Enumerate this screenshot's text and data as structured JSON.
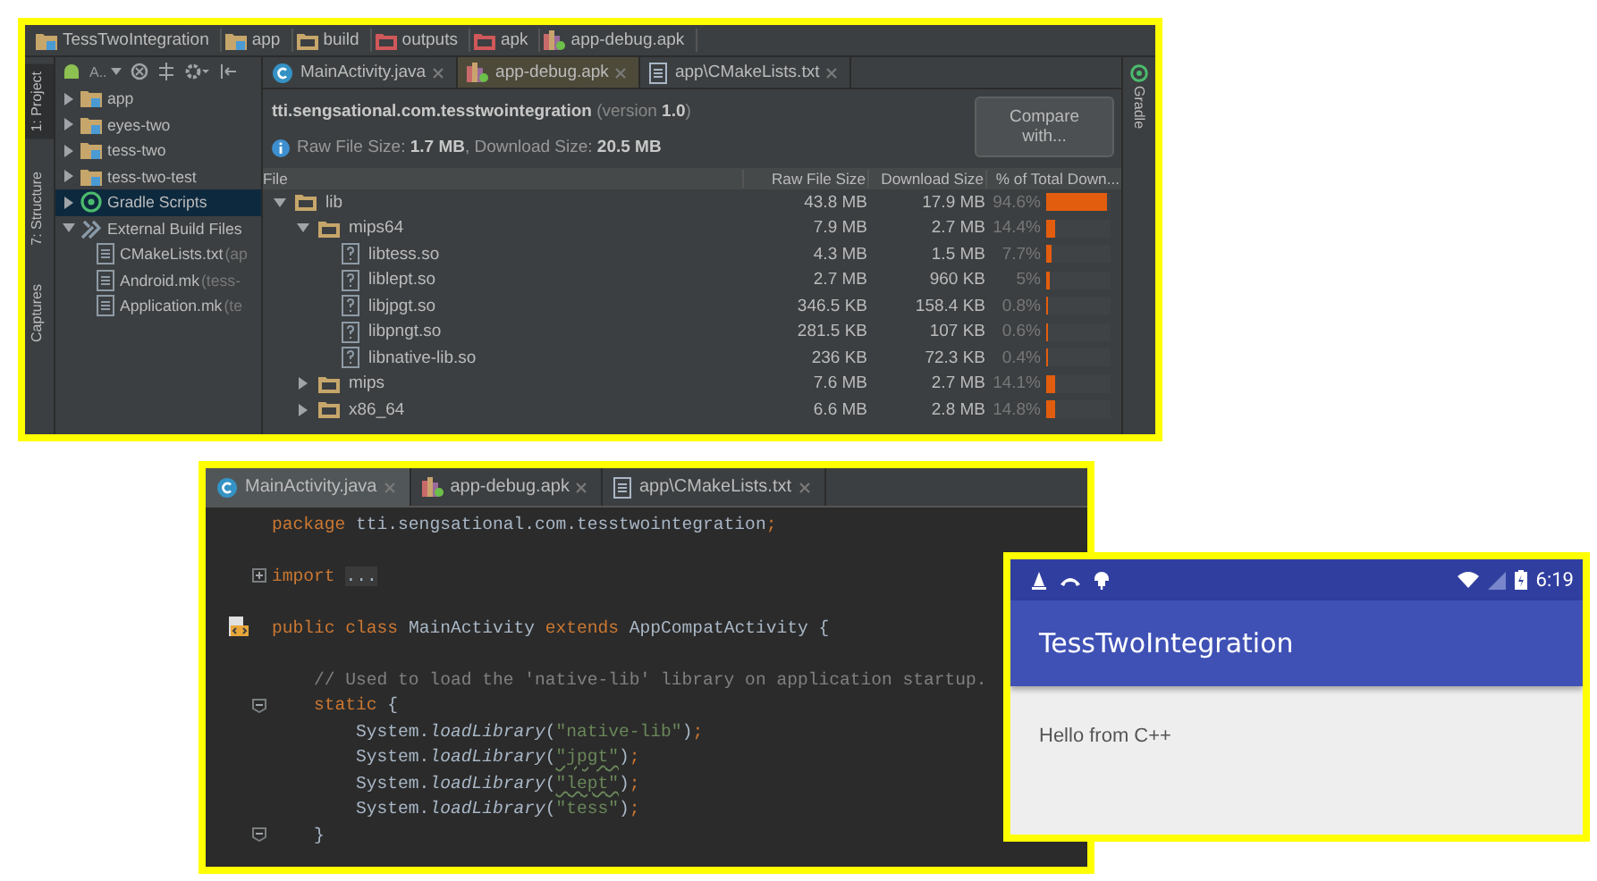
{
  "ide_window": {
    "breadcrumbs": [
      {
        "label": "TessTwoIntegration",
        "kind": "module"
      },
      {
        "label": "app",
        "kind": "module"
      },
      {
        "label": "build",
        "kind": "folder"
      },
      {
        "label": "outputs",
        "kind": "red_folder"
      },
      {
        "label": "apk",
        "kind": "red_folder"
      },
      {
        "label": "app-debug.apk",
        "kind": "apk"
      }
    ],
    "left_tool_tabs": [
      {
        "label": "1: Project",
        "selected": true
      },
      {
        "label": "7: Structure",
        "selected": false
      },
      {
        "label": "Captures",
        "selected": false
      }
    ],
    "right_tool_tab": "Gradle",
    "project_selector": "A..",
    "project_tree": [
      {
        "label": "app",
        "kind": "module",
        "expanded": false,
        "selected": false
      },
      {
        "label": "eyes-two",
        "kind": "module",
        "expanded": false,
        "selected": false
      },
      {
        "label": "tess-two",
        "kind": "module",
        "expanded": false,
        "selected": false
      },
      {
        "label": "tess-two-test",
        "kind": "module",
        "expanded": false,
        "selected": false
      },
      {
        "label": "Gradle Scripts",
        "kind": "gradle",
        "expanded": false,
        "selected": true
      },
      {
        "label": "External Build Files",
        "kind": "external",
        "expanded": true,
        "selected": false,
        "children": [
          {
            "label": "CMakeLists.txt",
            "hint": "(ap",
            "kind": "file",
            "selected": false
          },
          {
            "label": "Android.mk",
            "hint": "(tess-",
            "kind": "file",
            "selected": false
          },
          {
            "label": "Application.mk",
            "hint": "(te",
            "kind": "file",
            "selected": false
          }
        ]
      }
    ],
    "editor_tabs": [
      {
        "label": "MainActivity.java",
        "kind": "class",
        "selected": false
      },
      {
        "label": "app-debug.apk",
        "kind": "apk",
        "selected": true
      },
      {
        "label": "app\\CMakeLists.txt",
        "kind": "text",
        "selected": false
      }
    ],
    "apk_package": "tti.sengsational.com.tesstwointegration",
    "apk_version": "(version **1.0**)",
    "apk_sizes": "Raw File Size: **1.7 MB**, Download Size: **20.5 MB**",
    "compare_button": "Compare with...",
    "table": {
      "columns": [
        "File",
        "Raw File Size",
        "Download Size",
        "% of Total Down..."
      ],
      "rows": [
        {
          "name": "lib",
          "kind": "folder",
          "expanded": true,
          "raw": "43.8 MB",
          "download": "17.9 MB",
          "percent": "94.6%",
          "level": 0.946,
          "children": [
            {
              "name": "mips64",
              "kind": "folder",
              "expanded": true,
              "raw": "7.9 MB",
              "download": "2.7 MB",
              "percent": "14.4%",
              "level": 0.144,
              "children": [
                {
                  "name": "libtess.so",
                  "kind": "file",
                  "raw": "4.3 MB",
                  "download": "1.5 MB",
                  "percent": "7.7%",
                  "level": 0.077
                },
                {
                  "name": "liblept.so",
                  "kind": "file",
                  "raw": "2.7 MB",
                  "download": "960 KB",
                  "percent": "5%",
                  "level": 0.05
                },
                {
                  "name": "libjpgt.so",
                  "kind": "file",
                  "raw": "346.5 KB",
                  "download": "158.4 KB",
                  "percent": "0.8%",
                  "level": 0.008
                },
                {
                  "name": "libpngt.so",
                  "kind": "file",
                  "raw": "281.5 KB",
                  "download": "107 KB",
                  "percent": "0.6%",
                  "level": 0.006
                },
                {
                  "name": "libnative-lib.so",
                  "kind": "file",
                  "raw": "236 KB",
                  "download": "72.3 KB",
                  "percent": "0.4%",
                  "level": 0.004
                }
              ]
            },
            {
              "name": "mips",
              "kind": "folder",
              "expanded": false,
              "raw": "7.6 MB",
              "download": "2.7 MB",
              "percent": "14.1%",
              "level": 0.141
            },
            {
              "name": "x86_64",
              "kind": "folder",
              "expanded": false,
              "raw": "6.6 MB",
              "download": "2.8 MB",
              "percent": "14.8%",
              "level": 0.148
            }
          ]
        }
      ]
    }
  },
  "editor_window": {
    "tabs": [
      {
        "label": "MainActivity.java",
        "kind": "class",
        "selected": true
      },
      {
        "label": "app-debug.apk",
        "kind": "apk",
        "selected": false
      },
      {
        "label": "app\\CMakeLists.txt",
        "kind": "text",
        "selected": false
      }
    ],
    "lines": [
      {
        "kind": "code",
        "segments": [
          {
            "kind": "keyword",
            "text": "package"
          },
          {
            "kind": "plain",
            "text": " tti.sengsational.com.tesstwointegration"
          },
          {
            "kind": "keyword",
            "text": ";"
          }
        ]
      },
      {
        "kind": "blank"
      },
      {
        "kind": "import_fold",
        "segments": [
          {
            "kind": "keyword",
            "text": "import"
          },
          {
            "kind": "folded",
            "text": "..."
          }
        ]
      },
      {
        "kind": "blank"
      },
      {
        "kind": "class_decl",
        "segments": [
          {
            "kind": "keyword",
            "text": "public class"
          },
          {
            "kind": "plain",
            "text": " MainActivity "
          },
          {
            "kind": "keyword",
            "text": "extends"
          },
          {
            "kind": "plain",
            "text": " AppCompatActivity {"
          }
        ]
      },
      {
        "kind": "blank"
      },
      {
        "kind": "code",
        "segments": [
          {
            "kind": "comment",
            "text": "    // Used to load the 'native-lib' library on application startup."
          }
        ]
      },
      {
        "kind": "block_start",
        "segments": [
          {
            "kind": "keyword",
            "text": "    static"
          },
          {
            "kind": "plain",
            "text": " {"
          }
        ]
      },
      {
        "kind": "code",
        "segments": [
          {
            "kind": "plain",
            "text": "        System."
          },
          {
            "kind": "method",
            "text": "loadLibrary"
          },
          {
            "kind": "plain",
            "text": "("
          },
          {
            "kind": "string",
            "text": "\"native-lib\""
          },
          {
            "kind": "plain",
            "text": ")"
          },
          {
            "kind": "keyword",
            "text": ";"
          }
        ]
      },
      {
        "kind": "code",
        "segments": [
          {
            "kind": "plain",
            "text": "        System."
          },
          {
            "kind": "method",
            "text": "loadLibrary"
          },
          {
            "kind": "plain",
            "text": "("
          },
          {
            "kind": "typo_string",
            "text": "\"jpgt\""
          },
          {
            "kind": "plain",
            "text": ")"
          },
          {
            "kind": "keyword",
            "text": ";"
          }
        ]
      },
      {
        "kind": "code",
        "segments": [
          {
            "kind": "plain",
            "text": "        System."
          },
          {
            "kind": "method",
            "text": "loadLibrary"
          },
          {
            "kind": "plain",
            "text": "("
          },
          {
            "kind": "typo_string",
            "text": "\"lept\""
          },
          {
            "kind": "plain",
            "text": ")"
          },
          {
            "kind": "keyword",
            "text": ";"
          }
        ]
      },
      {
        "kind": "code",
        "segments": [
          {
            "kind": "plain",
            "text": "        System."
          },
          {
            "kind": "method",
            "text": "loadLibrary"
          },
          {
            "kind": "plain",
            "text": "("
          },
          {
            "kind": "string",
            "text": "\"tess\""
          },
          {
            "kind": "plain",
            "text": ")"
          },
          {
            "kind": "keyword",
            "text": ";"
          }
        ]
      },
      {
        "kind": "block_end",
        "segments": [
          {
            "kind": "plain",
            "text": "    }"
          }
        ]
      }
    ]
  },
  "device_window": {
    "status_time": "6:19",
    "app_title": "TessTwoIntegration",
    "message": "Hello from C++"
  }
}
